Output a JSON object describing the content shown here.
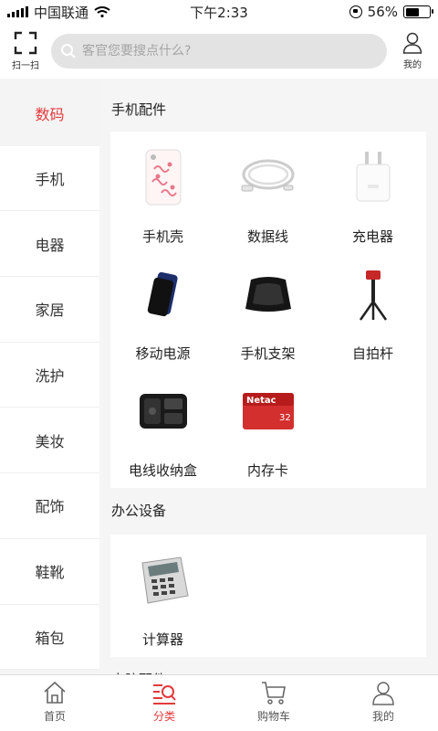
{
  "status": {
    "carrier": "中国联通",
    "time": "下午2:33",
    "battery": "56%",
    "battery_level": 0.56
  },
  "header": {
    "scan_label": "扫一扫",
    "search_placeholder": "客官您要搜点什么?",
    "me_label": "我的"
  },
  "sidebar": {
    "items": [
      {
        "label": "数码",
        "active": true
      },
      {
        "label": "手机"
      },
      {
        "label": "电器"
      },
      {
        "label": "家居"
      },
      {
        "label": "洗护"
      },
      {
        "label": "美妆"
      },
      {
        "label": "配饰"
      },
      {
        "label": "鞋靴"
      },
      {
        "label": "箱包"
      }
    ]
  },
  "sections": [
    {
      "title": "手机配件",
      "items": [
        {
          "label": "手机壳",
          "icon": "phone-case-icon"
        },
        {
          "label": "数据线",
          "icon": "data-cable-icon"
        },
        {
          "label": "充电器",
          "icon": "charger-icon"
        },
        {
          "label": "移动电源",
          "icon": "power-bank-icon"
        },
        {
          "label": "手机支架",
          "icon": "phone-stand-icon"
        },
        {
          "label": "自拍杆",
          "icon": "selfie-stick-icon"
        },
        {
          "label": "电线收纳盒",
          "icon": "cable-organizer-icon"
        },
        {
          "label": "内存卡",
          "icon": "memory-card-icon",
          "brand": "Netac",
          "capacity": "32"
        }
      ]
    },
    {
      "title": "办公设备",
      "items": [
        {
          "label": "计算器",
          "icon": "calculator-icon"
        }
      ]
    },
    {
      "title": "电脑配件"
    }
  ],
  "tabbar": {
    "items": [
      {
        "label": "首页",
        "icon": "home-icon"
      },
      {
        "label": "分类",
        "icon": "category-icon",
        "active": true
      },
      {
        "label": "购物车",
        "icon": "cart-icon"
      },
      {
        "label": "我的",
        "icon": "profile-icon"
      }
    ]
  },
  "colors": {
    "accent": "#e4393c",
    "card": "#ffffff",
    "page_bg": "#f5f5f5"
  }
}
